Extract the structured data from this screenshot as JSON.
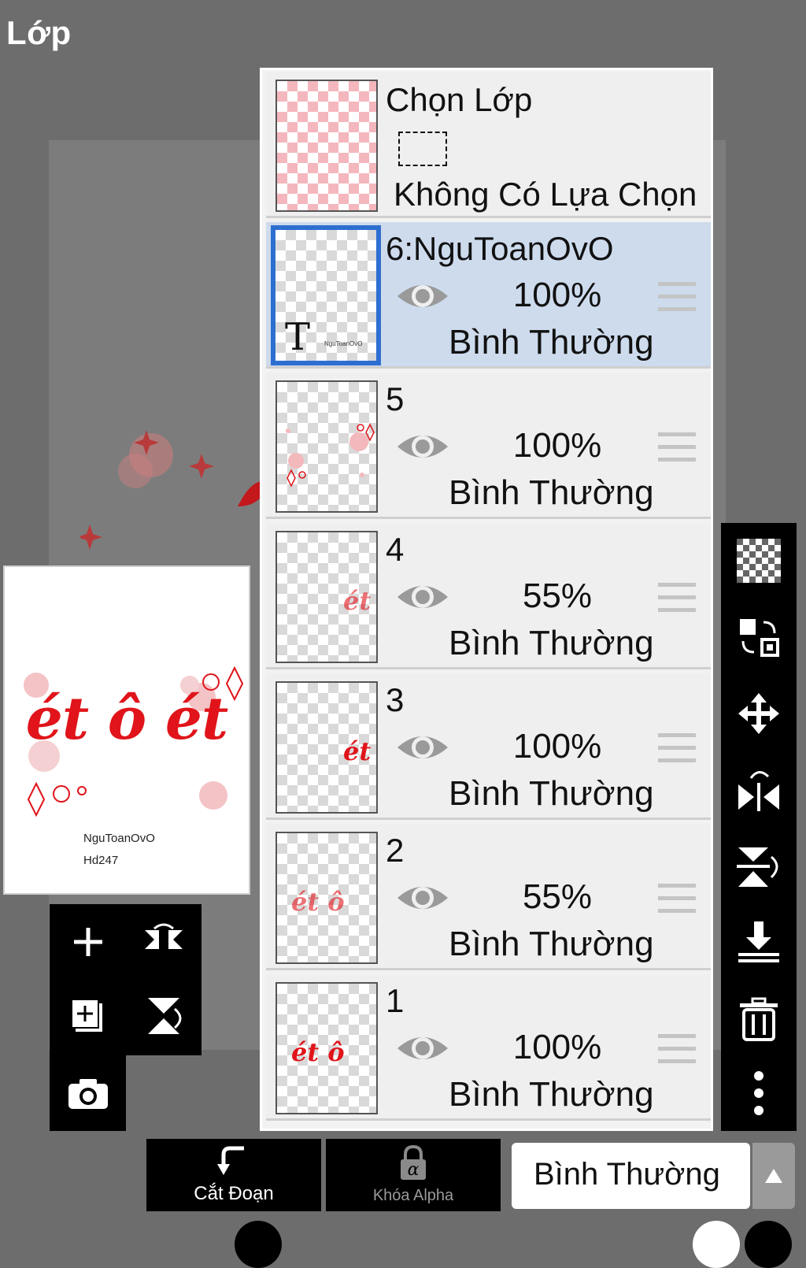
{
  "screen": {
    "title": "Lớp"
  },
  "preview": {
    "artwork_text": "ét ô ét",
    "signature_line1": "NguToanOvO",
    "signature_line2": "Hd247"
  },
  "left_tools": [
    {
      "name": "add-layer-icon"
    },
    {
      "name": "flip-horizontal-icon"
    },
    {
      "name": "add-paper-layer-icon"
    },
    {
      "name": "flip-vertical-icon"
    },
    {
      "name": "camera-icon"
    }
  ],
  "layers_panel": {
    "selection_layer": {
      "label": "Chọn Lớp",
      "status": "Không Có Lựa Chọn"
    },
    "layers": [
      {
        "name": "6:NguToanOvO",
        "opacity": "100%",
        "blend": "Bình Thường",
        "selected": true,
        "thumb_text": "T",
        "thumb_small": "NguToanOvO"
      },
      {
        "name": "5",
        "opacity": "100%",
        "blend": "Bình Thường",
        "selected": false
      },
      {
        "name": "4",
        "opacity": "55%",
        "blend": "Bình Thường",
        "selected": false,
        "thumb_text": "ét"
      },
      {
        "name": "3",
        "opacity": "100%",
        "blend": "Bình Thường",
        "selected": false,
        "thumb_text": "ét"
      },
      {
        "name": "2",
        "opacity": "55%",
        "blend": "Bình Thường",
        "selected": false,
        "thumb_text": "ét ô"
      },
      {
        "name": "1",
        "opacity": "100%",
        "blend": "Bình Thường",
        "selected": false,
        "thumb_text": "ét ô"
      }
    ]
  },
  "right_tools": [
    {
      "name": "transparency-checker-icon"
    },
    {
      "name": "swap-layers-icon"
    },
    {
      "name": "move-icon"
    },
    {
      "name": "flip-horizontal-icon"
    },
    {
      "name": "flip-vertical-icon"
    },
    {
      "name": "merge-down-icon"
    },
    {
      "name": "delete-icon"
    },
    {
      "name": "more-icon"
    }
  ],
  "bottom_bar": {
    "clip_label": "Cắt Đoạn",
    "alpha_lock_label": "Khóa Alpha",
    "blend_mode_value": "Bình Thường"
  },
  "colors": {
    "background": "#6d6d6d",
    "selected_row": "#cddbed",
    "selected_border": "#2d6fd1",
    "art_red": "#e0141a"
  }
}
